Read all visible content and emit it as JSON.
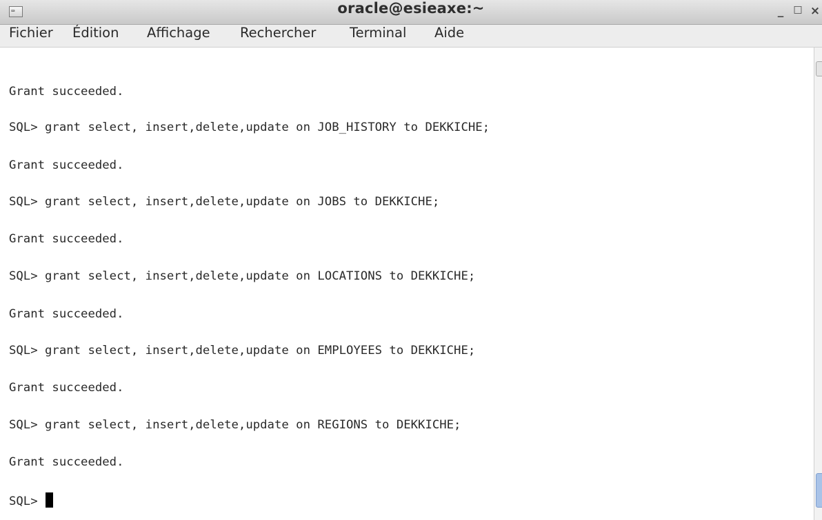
{
  "window": {
    "title": "oracle@esieaxe:~",
    "icon_label": "⌨",
    "controls": {
      "minimize": "_",
      "maximize": "□",
      "close": "×"
    }
  },
  "menu": {
    "items": [
      {
        "label": "Fichier"
      },
      {
        "label": "Édition"
      },
      {
        "label": "Affichage"
      },
      {
        "label": "Rechercher"
      },
      {
        "label": "Terminal"
      },
      {
        "label": "Aide"
      }
    ]
  },
  "terminal": {
    "lines": [
      "Grant succeeded.",
      "SQL> grant select, insert,delete,update on JOB_HISTORY to DEKKICHE;",
      "Grant succeeded.",
      "SQL> grant select, insert,delete,update on JOBS to DEKKICHE;",
      "Grant succeeded.",
      "SQL> grant select, insert,delete,update on LOCATIONS to DEKKICHE;",
      "Grant succeeded.",
      "SQL> grant select, insert,delete,update on EMPLOYEES to DEKKICHE;",
      "Grant succeeded.",
      "SQL> grant select, insert,delete,update on REGIONS to DEKKICHE;",
      "Grant succeeded."
    ],
    "prompt": "SQL> "
  },
  "icons": {
    "app": "terminal-icon",
    "minimize": "minimize-icon",
    "maximize": "maximize-icon",
    "close": "close-icon"
  }
}
